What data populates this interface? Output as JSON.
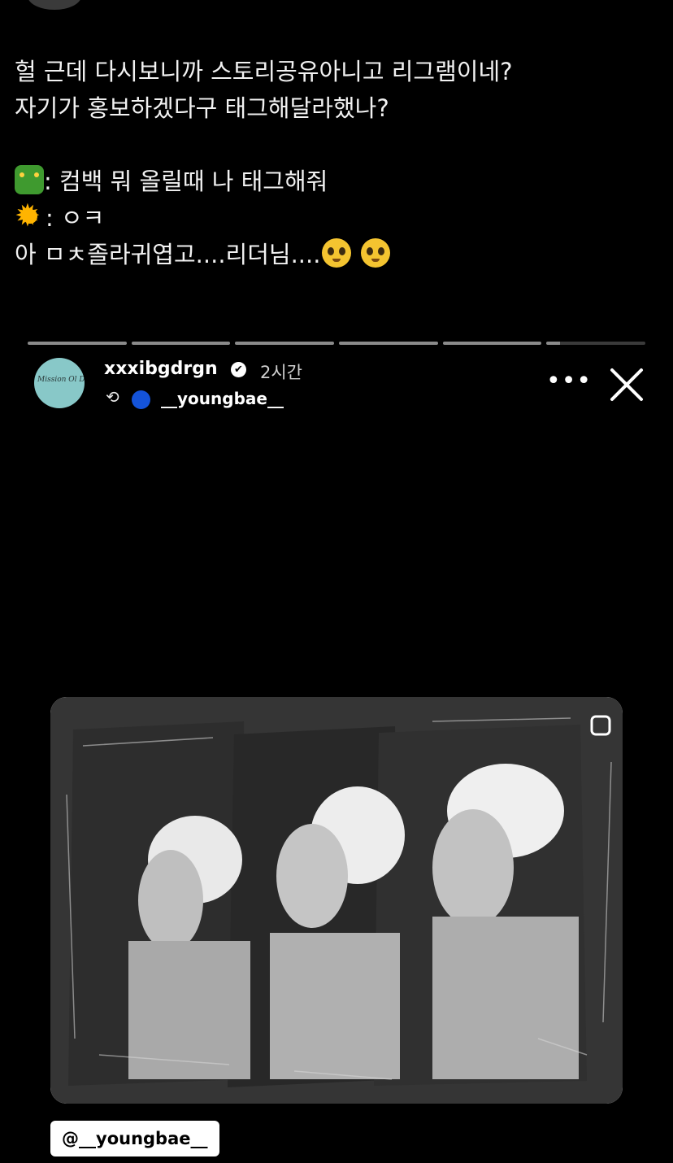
{
  "post": {
    "line1": "헐 근데 다시보니까 스토리공유아니고 리그램이네?",
    "line2": "자기가 홍보하겠다구 태그해달라했나?",
    "line3_text": ": 컴백 뭐 올릴때 나 태그해줘",
    "line4_text": ": ㅇㅋ",
    "line5_text": "아 ㅁㅊ졸라귀엽고....리더님....",
    "icons": [
      "dragon-emoji",
      "sun-emoji",
      "pleading-face-emoji",
      "pleading-face-emoji"
    ]
  },
  "story": {
    "progress_segments": 6,
    "current_segment_progress": 0.14,
    "username": "xxxibgdrgn",
    "verified_mark": "✔",
    "time_ago": "2시간",
    "repost_from": "__youngbae__",
    "more_label": "•••",
    "mention_tag": "@__youngbae__",
    "avatar_text": "Mission Ol Dragon",
    "colors": {
      "background": "#000000",
      "avatar": "#88c8c8",
      "repost_dot": "#1453d9"
    }
  }
}
